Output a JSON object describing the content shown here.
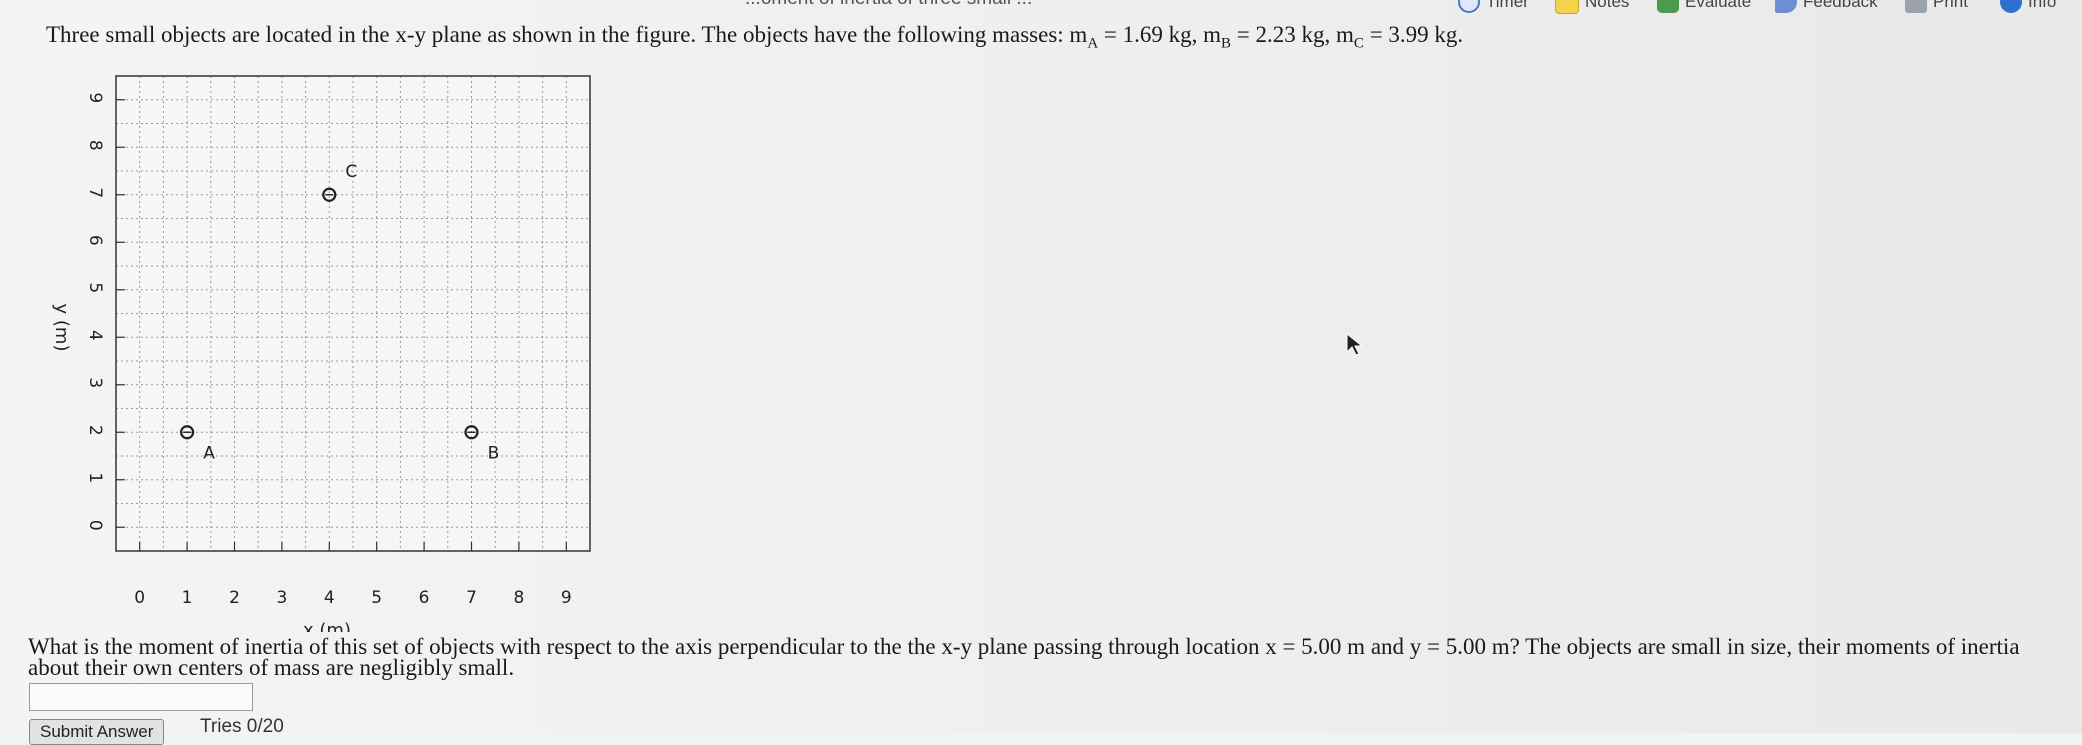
{
  "toolbar": {
    "title_fragment": "...oment of inertia of three small ...",
    "items": [
      {
        "label": "Timer",
        "icon": "timer-icon"
      },
      {
        "label": "Notes",
        "icon": "notes-icon"
      },
      {
        "label": "Evaluate",
        "icon": "evaluate-icon"
      },
      {
        "label": "Feedback",
        "icon": "feedback-icon"
      },
      {
        "label": "Print",
        "icon": "print-icon"
      },
      {
        "label": "Info",
        "icon": "info-icon"
      }
    ]
  },
  "question": {
    "intro": "Three small objects are located in the x-y plane as shown in the figure. The objects have the following masses: ",
    "mA_sym": "m",
    "mA_sub": "A",
    "mA_val": " = 1.69 kg, ",
    "mB_sym": "m",
    "mB_sub": "B",
    "mB_val": " = 2.23 kg, ",
    "mC_sym": "m",
    "mC_sub": "C",
    "mC_val": " = 3.99 kg."
  },
  "chart_data": {
    "type": "scatter",
    "xlabel": "x (m)",
    "ylabel": "y (m)",
    "xlim": [
      -0.5,
      9.5
    ],
    "ylim": [
      -0.5,
      9.5
    ],
    "xticks": [
      0,
      1,
      2,
      3,
      4,
      5,
      6,
      7,
      8,
      9
    ],
    "yticks": [
      0,
      1,
      2,
      3,
      4,
      5,
      6,
      7,
      8,
      9
    ],
    "grid": true,
    "points": [
      {
        "label": "A",
        "x": 1,
        "y": 2
      },
      {
        "label": "B",
        "x": 7,
        "y": 2
      },
      {
        "label": "C",
        "x": 4,
        "y": 7
      }
    ]
  },
  "prompt": {
    "text": "What is the moment of inertia of this set of objects with respect to the axis perpendicular to the the x-y plane passing through location x = 5.00 m and y = 5.00 m? The objects are small in size, their moments of inertia about their own centers of mass are negligibly small."
  },
  "answer": {
    "value": "",
    "placeholder": ""
  },
  "submit": {
    "label": "Submit Answer"
  },
  "tries": {
    "text": "Tries 0/20"
  },
  "colors": {
    "timer": "#4a78c8",
    "notes": "#f2d34a",
    "evaluate": "#4c9b4c",
    "info": "#2f6fd0"
  }
}
